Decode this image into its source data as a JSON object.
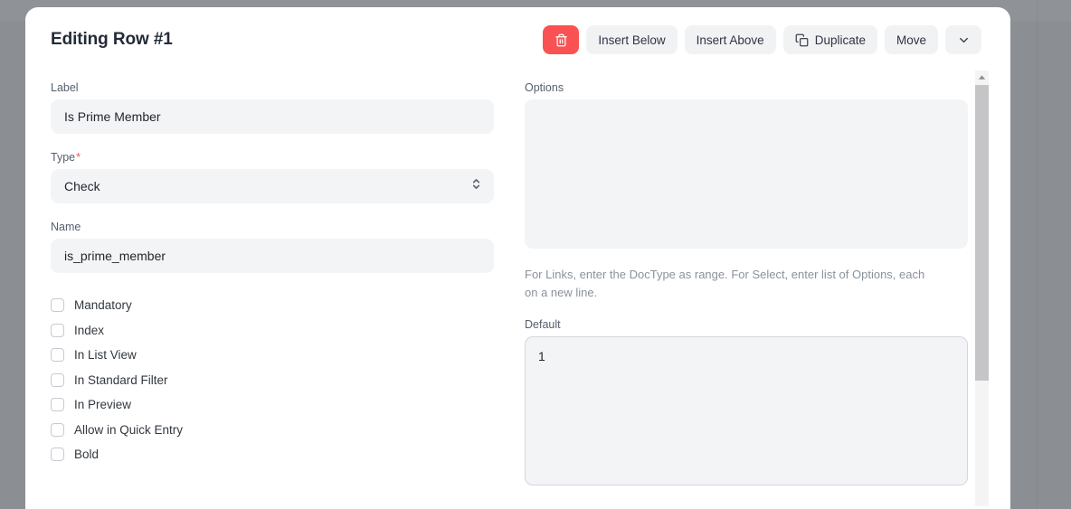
{
  "dialog": {
    "title": "Editing Row #1"
  },
  "toolbar": {
    "delete_label": "",
    "delete_icon": "trash-icon",
    "insert_below_label": "Insert Below",
    "insert_above_label": "Insert Above",
    "duplicate_label": "Duplicate",
    "duplicate_icon": "copy-icon",
    "move_label": "Move",
    "more_icon": "chevron-down-icon",
    "danger_color": "#fa5252",
    "button_bg": "#f1f2f4"
  },
  "left_column": {
    "label_field": {
      "label": "Label",
      "value": "Is Prime Member",
      "placeholder": ""
    },
    "type_field": {
      "label": "Type",
      "required_marker": "*",
      "value": "Check",
      "options": [
        "Check"
      ]
    },
    "name_field": {
      "label": "Name",
      "value": "is_prime_member",
      "placeholder": ""
    },
    "checkboxes": [
      {
        "label": "Mandatory",
        "checked": false
      },
      {
        "label": "Index",
        "checked": false
      },
      {
        "label": "In List View",
        "checked": false
      },
      {
        "label": "In Standard Filter",
        "checked": false
      },
      {
        "label": "In Preview",
        "checked": false
      },
      {
        "label": "Allow in Quick Entry",
        "checked": false
      },
      {
        "label": "Bold",
        "checked": false
      }
    ]
  },
  "right_column": {
    "options_field": {
      "label": "Options",
      "value": "",
      "placeholder": ""
    },
    "help_text": "For Links, enter the DocType as range. For Select, enter list of Options, each on a new line.",
    "default_field": {
      "label": "Default",
      "value": "1",
      "placeholder": "",
      "focused": true
    }
  },
  "scrollbar": {
    "up_arrow_icon": "scroll-up-arrow-icon",
    "thumb_name": "scrollbar-thumb"
  }
}
